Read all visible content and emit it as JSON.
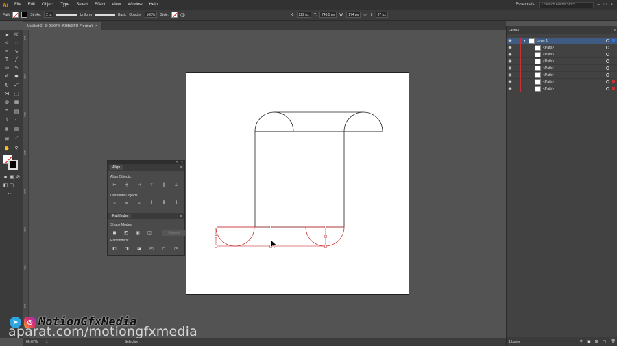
{
  "app": {
    "logo": "Ai"
  },
  "menu": [
    "File",
    "Edit",
    "Object",
    "Type",
    "Select",
    "Effect",
    "View",
    "Window",
    "Help"
  ],
  "workspace": "Essentials",
  "search_placeholder": "Search Adobe Stock",
  "control_bar": {
    "selection_type": "Path",
    "stroke_label": "Stroke:",
    "stroke_weight": "2 pt",
    "profile": "Uniform",
    "brush": "Basic",
    "opacity_label": "Opacity:",
    "opacity": "100%",
    "style_label": "Style:",
    "x_label": "X:",
    "x": "222 px",
    "y_label": "Y:",
    "y": "748.5 px",
    "w_label": "W:",
    "w": "174 px",
    "h_label": "H:",
    "h": "87 px"
  },
  "document_tab": {
    "title": "Untitled-1* @ 66.67% (RGB/GPU Preview)",
    "close": "×"
  },
  "ruler_left_labels": [
    "100",
    "200",
    "300",
    "400",
    "500",
    "600",
    "700",
    "800"
  ],
  "align_panel": {
    "title": "Align",
    "align_objects": "Align Objects:",
    "distribute_objects": "Distribute Objects:"
  },
  "pathfinder_panel": {
    "title": "Pathfinder",
    "shape_modes": "Shape Modes:",
    "expand": "Expand",
    "pathfinders": "Pathfinders:"
  },
  "layers_panel": {
    "title": "Layers",
    "layer_name": "Layer 1",
    "paths": [
      "<Path>",
      "<Path>",
      "<Path>",
      "<Path>",
      "<Path>",
      "<Path>",
      "<Path>"
    ],
    "footer": "1 Layer"
  },
  "status": {
    "zoom": "66.67%",
    "page": "1",
    "tool": "Selection"
  },
  "watermark": {
    "brand": "MotionGfxMedia",
    "url": "aparat.com/motiongfxmedia"
  },
  "colors": {
    "selection": "#c83232",
    "ui_dark": "#3b3b3b",
    "canvas": "#535353",
    "accent_logo": "#ff9a00"
  },
  "icons": [
    "selection-tool-icon",
    "direct-selection-icon",
    "pen-icon",
    "type-icon",
    "line-icon",
    "rectangle-icon",
    "brush-icon",
    "rotate-icon",
    "scale-icon",
    "eyedropper-icon",
    "hand-icon",
    "zoom-icon",
    "telegram-icon",
    "instagram-icon"
  ]
}
